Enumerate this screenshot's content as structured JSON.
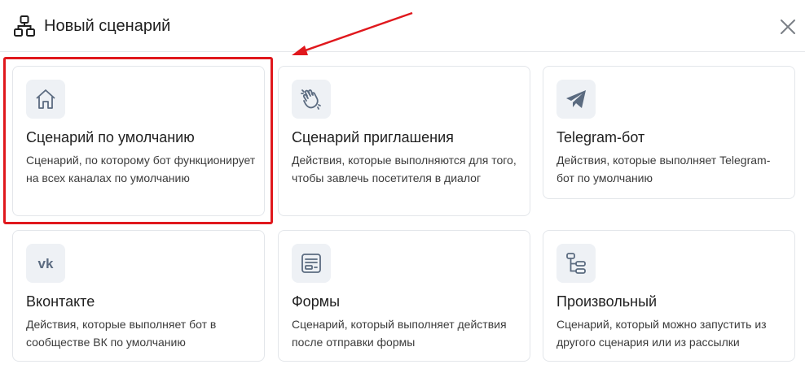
{
  "header": {
    "title": "Новый сценарий",
    "icon": "flow-chart-icon",
    "close_icon": "close-icon"
  },
  "cards": [
    {
      "icon": "home-icon",
      "title": "Сценарий по умолчанию",
      "description": "Сценарий, по которому бот функционирует на всех каналах по умолчанию"
    },
    {
      "icon": "waving-hand-icon",
      "title": "Сценарий приглашения",
      "description": "Действия, которые выполняются для того, чтобы завлечь посетителя в диалог"
    },
    {
      "icon": "telegram-icon",
      "title": "Telegram-бот",
      "description": "Действия, которые выполняет Telegram-бот по умолчанию"
    },
    {
      "icon": "vk-icon",
      "title": "Вконтакте",
      "description": "Действия, которые выполняет бот в сообществе ВК по умолчанию"
    },
    {
      "icon": "form-icon",
      "title": "Формы",
      "description": "Сценарий, который выполняет действия после отправки формы"
    },
    {
      "icon": "flow-steps-icon",
      "title": "Произвольный",
      "description": "Сценарий, который можно запустить из другого сценария или из рассылки"
    }
  ],
  "annotation": {
    "highlight_color": "#e0181d"
  },
  "colors": {
    "icon_bg": "#eef1f5",
    "icon_fg": "#5b6b80",
    "border": "#e3e6ea"
  }
}
